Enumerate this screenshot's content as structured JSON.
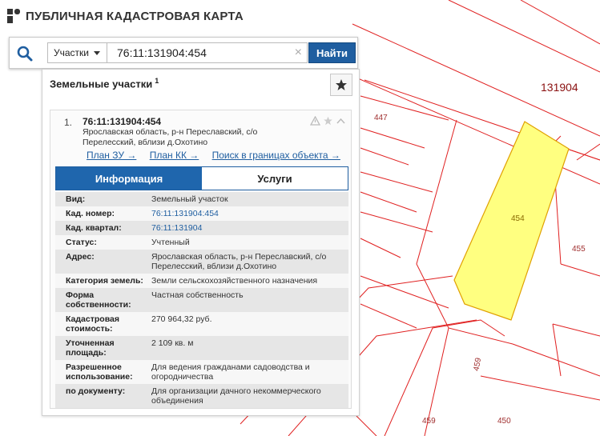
{
  "app": {
    "title": "ПУБЛИЧНАЯ КАДАСТРОВАЯ КАРТА"
  },
  "search": {
    "type_label": "Участки",
    "query": "76:11:131904:454",
    "clear_symbol": "×",
    "button_label": "Найти"
  },
  "panel": {
    "title": "Земельные участки",
    "count": "1"
  },
  "result": {
    "index": "1.",
    "cad_number": "76:11:131904:454",
    "address": "Ярославская область, р-н Переславский, с/о Перелесский, вблизи д.Охотино",
    "links": [
      "План ЗУ →",
      "План КК →",
      "Поиск в границах объекта →"
    ]
  },
  "tabs": [
    "Информация",
    "Услуги"
  ],
  "properties": [
    {
      "label": "Вид:",
      "value": "Земельный участок"
    },
    {
      "label": "Кад. номер:",
      "value": "76:11:131904:454"
    },
    {
      "label": "Кад. квартал:",
      "value": "76:11:131904"
    },
    {
      "label": "Статус:",
      "value": "Учтенный"
    },
    {
      "label": "Адрес:",
      "value": "Ярославская область, р-н Переславский, с/о Перелесский, вблизи д.Охотино"
    },
    {
      "label": "Категория земель:",
      "value": "Земли сельскохозяйственного назначения"
    },
    {
      "label": "Форма собственности:",
      "value": "Частная собственность"
    },
    {
      "label": "Кадастровая стоимость:",
      "value": "270 964,32 руб."
    },
    {
      "label": "Уточненная площадь:",
      "value": "2 109 кв. м"
    },
    {
      "label": "Разрешенное использование:",
      "value": "Для ведения гражданами садоводства и огородничества"
    },
    {
      "label": "по документу:",
      "value": "Для организации дачного некоммерческого объединения"
    }
  ],
  "map": {
    "quarter_label": "131904",
    "parcel_labels": [
      "447",
      "454",
      "455",
      "459",
      "459",
      "450"
    ],
    "colors": {
      "parcel_line": "#e02020",
      "selected_fill": "#ffff80",
      "selected_stroke": "#e0a000",
      "label": "#a03030",
      "accent": "#1f5ea0"
    }
  },
  "icons": {
    "logo": "rosreestr-logo",
    "search": "search-icon",
    "favorite": "star-icon",
    "warning": "warning-icon",
    "collapse": "chevron-up-icon"
  }
}
